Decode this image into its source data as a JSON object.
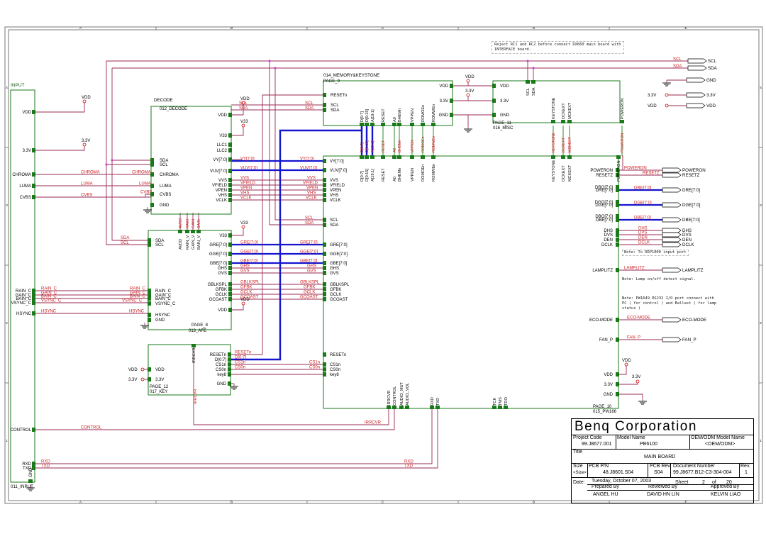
{
  "top_note": "Reject RC1 and RC2 before connect DX660 main board with\nINTERFACE board.",
  "border_columns": [
    "A",
    "B",
    "C",
    "D",
    "E"
  ],
  "border_rows": [
    "4",
    "3",
    "2",
    "1"
  ],
  "blocks": {
    "input": {
      "title": "INPUT",
      "footer": "011_INPUT"
    },
    "decode": {
      "title": "DECODE",
      "subtitle": "012_DECODE"
    },
    "afe": {
      "page": "PAGE_8",
      "footer": "013_AFE"
    },
    "key": {
      "page": "PAGE_12",
      "footer": "017_KEY"
    },
    "memory": {
      "title": "014_MEMORY&KEYSTONE",
      "page": "PAGE_9"
    },
    "misc": {
      "page": "PAGE_11",
      "footer": "016_MISC"
    },
    "pw166": {
      "page": "PAGE_10",
      "footer": "015_PW166"
    }
  },
  "power": {
    "vdd": "VDD",
    "v33": "3.3V",
    "gnd": "GND",
    "v33b": "V33"
  },
  "input_pins": [
    "VDD",
    "3.3V",
    "CHROMA",
    "LUMA",
    "CVBS",
    "RAIN_C",
    "GAIN_C",
    "BAIN_C",
    "VSYNC_C",
    "HSYNC",
    "CONTROL",
    "RXD",
    "TXD",
    "GND"
  ],
  "decode_left_pins": [
    "SDA",
    "SCL",
    "CHROMA",
    "LUMA",
    "CVBS",
    "GND"
  ],
  "decode_right_pins": [
    "VDD",
    "V33",
    "LLC1",
    "LLC2",
    "VY[7:0]",
    "VUV[7:0]",
    "VVS",
    "VFIELD",
    "VPEN",
    "VHS",
    "VCLK"
  ],
  "afe_left_pins": [
    "SDA",
    "SCL",
    "RAIN_C",
    "GAIN_C",
    "BAIN_C",
    "VSYNC_C",
    "HSYNC",
    "GND"
  ],
  "afe_top_pins": [
    "AVDD",
    "RAIN_V",
    "GAIN_V",
    "BAIN_V"
  ],
  "afe_right_pins": [
    "V33",
    "GRE[7:0]",
    "GGE[7:0]",
    "GBE[7:0]",
    "GHS",
    "GVS",
    "GBLKSPL",
    "GFBK",
    "GCLK",
    "GCOAST",
    "VDD"
  ],
  "key_left_pins": [
    "VDD",
    "3.3V"
  ],
  "key_right_pins": [
    "RESETn",
    "D[0:7]",
    "CS1n",
    "CS0n",
    "key8",
    "GND"
  ],
  "key_top_pins": [
    "IRRCVR"
  ],
  "memory_left_pins": [
    "RESETn",
    "SCL",
    "SDA"
  ],
  "memory_right_pins": [
    "VDD",
    "3.3V",
    "GND"
  ],
  "memory_bottom_pins": [
    "D[0:7]",
    "D[0:15]",
    "A[19:1]",
    "RESET",
    "A0",
    "BHEMn",
    "VPPEN",
    "ROMOEn",
    "ROMWEn"
  ],
  "misc_left_pins": [
    "VDD",
    "3.3V",
    "GND"
  ],
  "misc_top_pins": [
    "SCL",
    "SDA"
  ],
  "misc_bottom_pins": [
    "KEYSTONE",
    "DCKEXT",
    "MCKEXT",
    "POWERON"
  ],
  "pw_top_pins": [
    "D[0:7]",
    "D[0:15]",
    "A[19:1]",
    "RESET",
    "A0",
    "BHEMn",
    "VPPEN",
    "ROMOEn",
    "ROMWEn",
    "KEYSTONE",
    "DCKEXT",
    "MCKEXT",
    "POWERON"
  ],
  "pw_left_pins": [
    "VY[7:0]",
    "VUV[7:0]",
    "VVS",
    "VFIELD",
    "VPEN",
    "VHS",
    "VCLK",
    "SCL",
    "SDA",
    "GRE[7:0]",
    "GGE[7:0]",
    "GBE[7:0]",
    "GHS",
    "GVS",
    "GBLKSPL",
    "GFBK",
    "GCLK",
    "GCOAST",
    "RESETn",
    "CS1n",
    "CS0n",
    "key8"
  ],
  "pw_right_pins": [
    "POWERON",
    "RESETZ",
    "DRO[7:0]",
    "DRE[7:0]",
    "DGO[7:0]",
    "DGE[7:0]",
    "DBO[7:0]",
    "DBE[7:0]",
    "DHS",
    "DVS",
    "DEN",
    "DCLK",
    "LAMPLITZ",
    "ECO-MODE",
    "FAN_P",
    "VDD",
    "3.3V",
    "GND"
  ],
  "pw_bottom_pins": [
    "IRRCVR",
    "CONTROL",
    "AUDIO_MUT",
    "AUDIO_VOL",
    "RXD",
    "TXD",
    "TCK",
    "TMS",
    "TDO"
  ],
  "net_labels": {
    "chroma": "CHROMA",
    "luma": "LUMA",
    "cvbs": "CVBS",
    "rain": "RAIN_C",
    "gain": "GAIN_C",
    "bain": "BAIN_C",
    "vsync": "VSYNC_C",
    "hsync": "HSYNC",
    "sda": "SDA",
    "scl": "SCL",
    "vy": "VY[7:0]",
    "vuv": "VUV[7:0]",
    "vvs": "VVS",
    "vfield": "VFIELD",
    "vpen": "VPEN",
    "vhs": "VHS",
    "vclk": "VCLK",
    "gre": "GRE[7:0]",
    "gge": "GGE[7:0]",
    "gbe": "GBE[7:0]",
    "ghs": "GHS",
    "gvs": "GVS",
    "gblkspl": "GBLKSPL",
    "gfbk": "GFBK",
    "gclk": "GCLK",
    "gcoast": "GCOAST",
    "resetn": "RESETn",
    "d07": "D[0:7]",
    "cs1n": "CS1n",
    "cs0n": "CS0n",
    "irrcvr": "IRRCVR",
    "control": "CONTROL",
    "rxd": "RXD",
    "txd": "TXD",
    "poweron": "POWERON",
    "resetz": "RESETZ",
    "dre": "DRE[7:0]",
    "dge": "DGE[7:0]",
    "dbe": "DBE[7:0]",
    "dhs": "DHS",
    "dvs": "DVS",
    "den": "DEN",
    "dclk": "DCLK",
    "lamplitz": "LAMPLITZ",
    "ecomode": "ECO-MODE",
    "fanp": "FAN_P",
    "avdd": "AVDD",
    "rain_v": "RAIN",
    "gain_v": "GAIN",
    "bain_v": "BAIN"
  },
  "offpage": [
    "SCL",
    "SDA",
    "GND",
    "3.3V",
    "VDD",
    "POWERON",
    "RESETZ",
    "DRE[7:0]",
    "DGE[7:0]",
    "DBE[7:0]",
    "DHS",
    "DVS",
    "DEN",
    "DCLK",
    "LAMPLITZ",
    "ECO-MODE",
    "FAN_P"
  ],
  "notes": {
    "dgp": "Note: To DDP1000 input port",
    "lamp": "Note: Lamp on/off detect signal.",
    "pw": "Note: PW1649 RS232 I/O port connect with\nPC ( for control ) and Ballast ( for lamp\nstatus )"
  },
  "title_block": {
    "company": "Benq Corporation",
    "project_code_label": "Project Code",
    "project_code": "99.J8677.001",
    "model_name_label": "Model Name",
    "model_name": "PB6100",
    "oem_label": "OEM/ODM Model Name",
    "oem": "<OEM/ODM>",
    "title_label": "Title",
    "title": "MAIN BOARD",
    "size_label": "Size",
    "size": "<Size>",
    "pcb_pn_label": "PCB P/N",
    "pcb_pn": "48.J8601.S04",
    "pcb_rev_label": "PCB Rev.",
    "pcb_rev": "S04",
    "doc_label": "Document Number",
    "doc": "99.J8677.B12-C3-304-004",
    "rev_label": "Rev.",
    "rev": "1",
    "date_label": "Date:",
    "date": "Tuesday, October 07, 2003",
    "sheet_label": "Sheet",
    "sheet": "2",
    "of_label": "of",
    "of": "20",
    "prepared_label": "Prepared By",
    "prepared": "ANGEL HU",
    "reviewed_label": "Reviewed By",
    "reviewed": "DAVID HN LIN",
    "approved_label": "Approved By",
    "approved": "KELVIN LIAO"
  },
  "colors": {
    "block": "#1a7a1a",
    "wire": "#9a2a55",
    "bus": "#1515d0",
    "net": "#cc2020",
    "pin": "#1a7a1a",
    "border": "#555555"
  }
}
